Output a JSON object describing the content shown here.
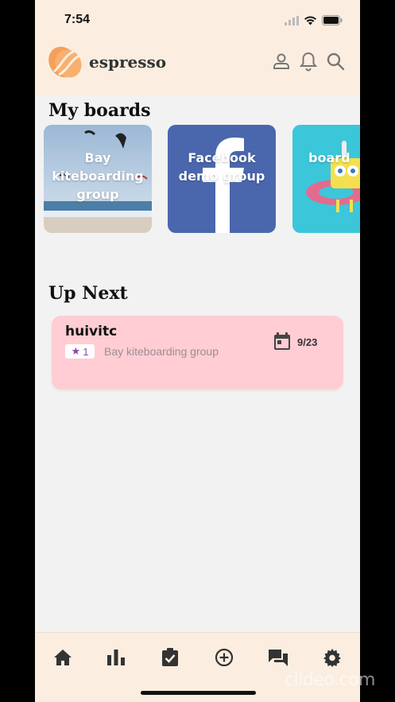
{
  "status_bar": {
    "time": "7:54"
  },
  "app": {
    "name": "espresso",
    "brand_color": "#f4a05a"
  },
  "header_icons": [
    "profile-icon",
    "bell-icon",
    "search-icon"
  ],
  "my_boards": {
    "title": "My boards",
    "items": [
      {
        "label": "Bay kiteboarding group",
        "image": "beach-kites"
      },
      {
        "label": "Facebook demo group",
        "image": "facebook-logo"
      },
      {
        "label": "board",
        "image": "spongebob"
      }
    ]
  },
  "up_next": {
    "title": "Up Next",
    "tasks": [
      {
        "title": "huivitc",
        "badge_icon": "star-icon",
        "badge_count": "1",
        "board": "Bay kiteboarding group",
        "date": "9/23"
      }
    ]
  },
  "bottom_nav": [
    "home-icon",
    "chart-icon",
    "task-check-icon",
    "add-circle-icon",
    "chat-icon",
    "settings-icon"
  ],
  "watermark": "clideo.com",
  "colors": {
    "task_card": "#ffcdd3",
    "header_bg": "#fbeee0",
    "facebook": "#4a67ad"
  }
}
